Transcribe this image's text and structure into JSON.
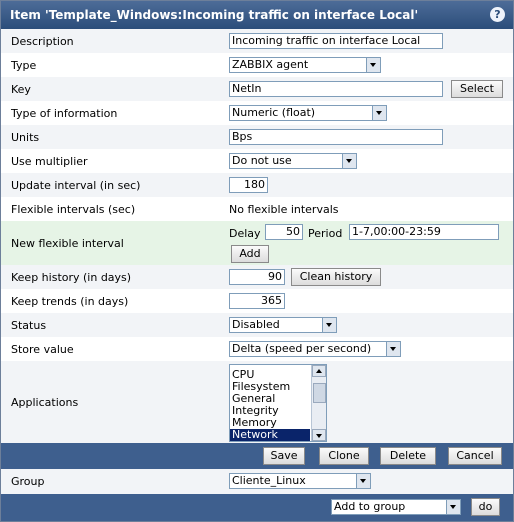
{
  "header": {
    "title": "Item 'Template_Windows:Incoming traffic on interface Local'"
  },
  "fields": {
    "description": {
      "label": "Description",
      "value": "Incoming traffic on interface Local"
    },
    "type": {
      "label": "Type",
      "value": "ZABBIX agent"
    },
    "key": {
      "label": "Key",
      "value": "NetIn",
      "select_label": "Select"
    },
    "type_of_information": {
      "label": "Type of information",
      "value": "Numeric (float)"
    },
    "units": {
      "label": "Units",
      "value": "Bps"
    },
    "use_multiplier": {
      "label": "Use multiplier",
      "value": "Do not use"
    },
    "update_interval": {
      "label": "Update interval (in sec)",
      "value": "180"
    },
    "flexible_intervals": {
      "label": "Flexible intervals (sec)",
      "value": "No flexible intervals"
    },
    "new_flexible_interval": {
      "label": "New flexible interval",
      "delay_label": "Delay",
      "delay_value": "50",
      "period_label": "Period",
      "period_value": "1-7,00:00-23:59",
      "add_label": "Add"
    },
    "keep_history": {
      "label": "Keep history (in days)",
      "value": "90",
      "clean_label": "Clean history"
    },
    "keep_trends": {
      "label": "Keep trends (in days)",
      "value": "365"
    },
    "status": {
      "label": "Status",
      "value": "Disabled"
    },
    "store_value": {
      "label": "Store value",
      "value": "Delta (speed per second)"
    },
    "applications": {
      "label": "Applications",
      "options": [
        "CPU",
        "Filesystem",
        "General",
        "Integrity",
        "Memory",
        "Network"
      ],
      "selected": "Network"
    }
  },
  "actions": {
    "save": "Save",
    "clone": "Clone",
    "delete": "Delete",
    "cancel": "Cancel"
  },
  "group": {
    "label": "Group",
    "value": "Cliente_Linux"
  },
  "footer": {
    "group_action": "Add to group",
    "do_label": "do"
  },
  "colors": {
    "titlebar": "#2b4d7a",
    "actionbar": "#3e5f8e",
    "alt_row": "#f2f4f7",
    "flex_row": "#e6f4e6"
  }
}
